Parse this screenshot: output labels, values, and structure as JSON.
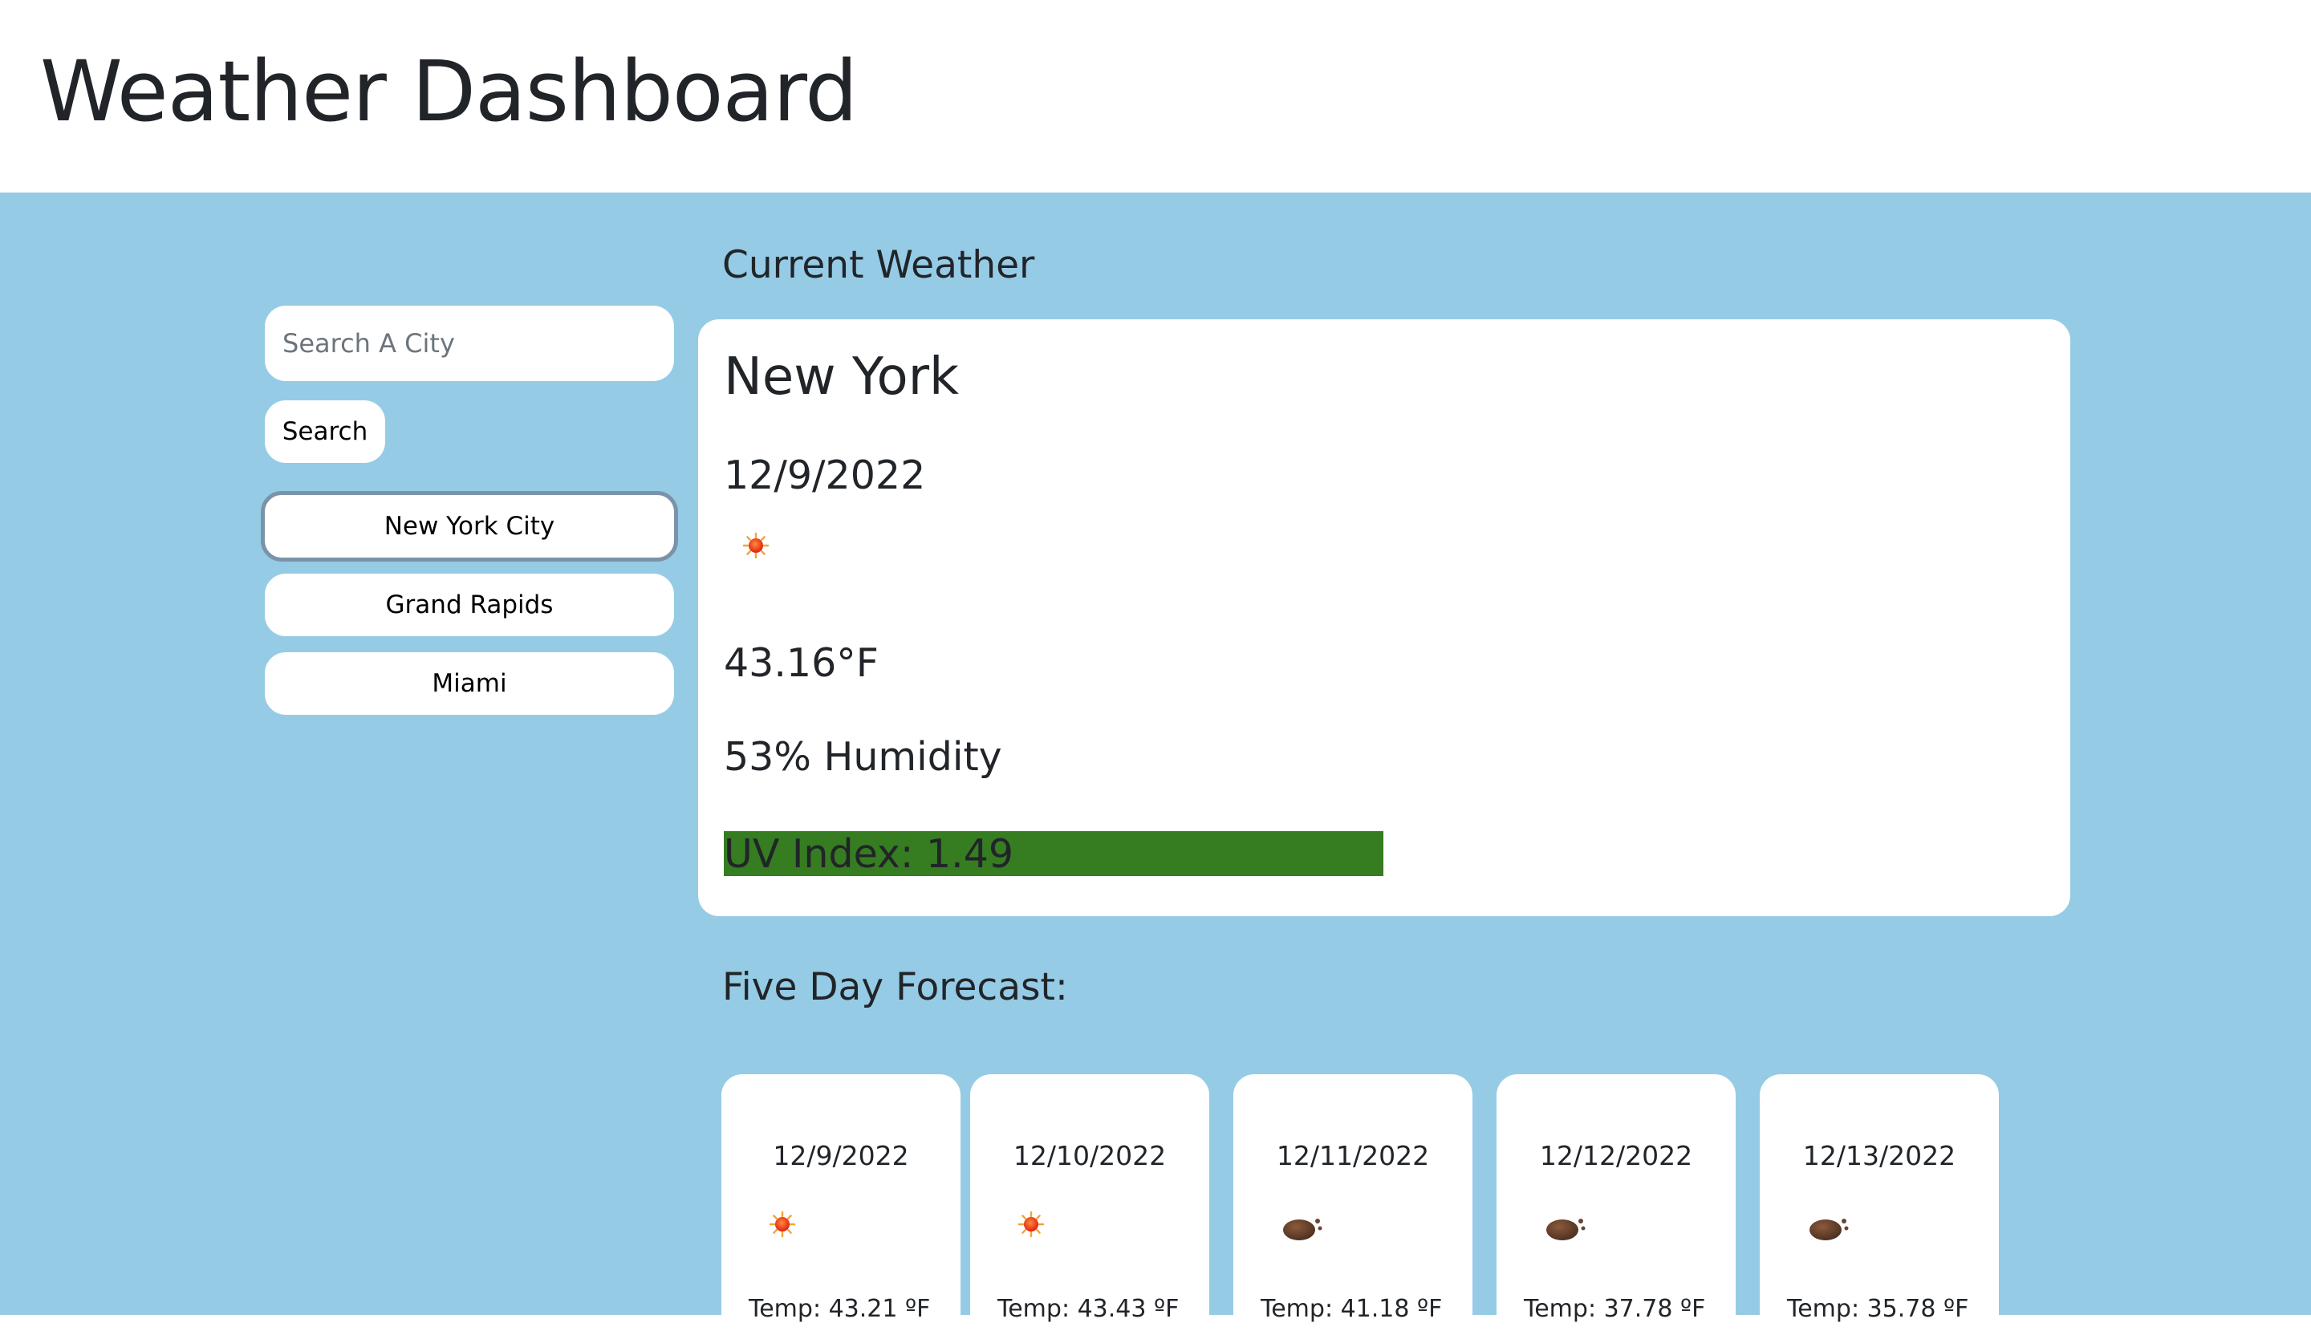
{
  "header": {
    "title": "Weather Dashboard"
  },
  "sidebar": {
    "search_placeholder": "Search A City",
    "search_button": "Search",
    "history": [
      "New York City",
      "Grand Rapids",
      "Miami"
    ]
  },
  "current": {
    "heading": "Current Weather",
    "city": "New York",
    "date": "12/9/2022",
    "icon": "sun-icon",
    "temperature": "43.16°F",
    "humidity": "53% Humidity",
    "uv_index": "UV Index: 1.49",
    "uv_color": "#367c21"
  },
  "forecast": {
    "heading": "Five Day Forecast:",
    "days": [
      {
        "date": "12/9/2022",
        "icon": "sun-icon",
        "temp": "Temp: 43.21 ºF"
      },
      {
        "date": "12/10/2022",
        "icon": "sun-icon",
        "temp": "Temp: 43.43 ºF"
      },
      {
        "date": "12/11/2022",
        "icon": "cloud-icon",
        "temp": "Temp: 41.18 ºF"
      },
      {
        "date": "12/12/2022",
        "icon": "cloud-icon",
        "temp": "Temp: 37.78 ºF"
      },
      {
        "date": "12/13/2022",
        "icon": "cloud-icon",
        "temp": "Temp: 35.78 ºF"
      }
    ]
  },
  "colors": {
    "background": "#96cbe6",
    "card": "#ffffff",
    "text": "#212529"
  }
}
